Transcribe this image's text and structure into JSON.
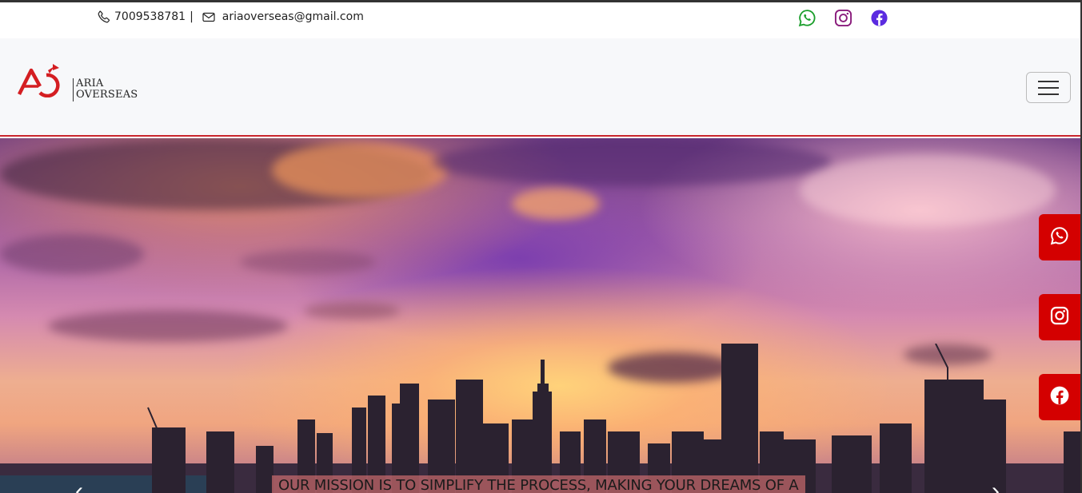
{
  "topbar": {
    "phone": "7009538781",
    "separator": "|",
    "email": "ariaoverseas@gmail.com",
    "social": [
      "whatsapp-icon",
      "instagram-icon",
      "facebook-icon"
    ]
  },
  "brand": {
    "line1": "ARIA",
    "line2": "OVERSEAS",
    "accent_color": "#d41e22"
  },
  "navbar": {
    "toggler": "hamburger-menu-icon"
  },
  "hero": {
    "caption": "OUR MISSION IS TO SIMPLIFY THE PROCESS, MAKING YOUR DREAMS OF A",
    "prev": "‹",
    "next": "›"
  },
  "floating_social": [
    "whatsapp-icon",
    "instagram-icon",
    "facebook-icon"
  ],
  "colors": {
    "floating_bg": "#d40000",
    "whatsapp": "#1a9e2b",
    "instagram": "#8a1c7c",
    "facebook": "#5b2be0"
  }
}
